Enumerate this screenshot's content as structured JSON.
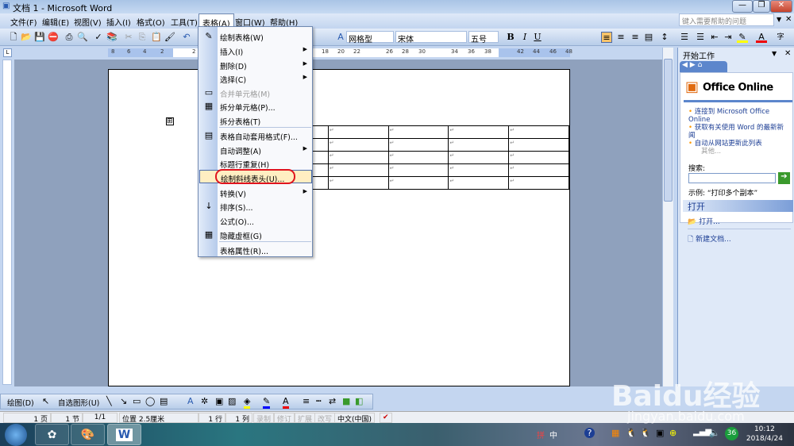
{
  "window": {
    "title": "文档 1 - Microsoft Word",
    "min": "—",
    "max": "❐",
    "close": "✕"
  },
  "menubar": [
    "文件(F)",
    "编辑(E)",
    "视图(V)",
    "插入(I)",
    "格式(O)",
    "工具(T)",
    "表格(A)",
    "窗口(W)",
    "帮助(H)"
  ],
  "help_placeholder": "键入需要帮助的问题",
  "toolbar": {
    "style": "网格型",
    "font": "宋体",
    "size": "五号",
    "bold": "B",
    "italic": "I",
    "underline": "U"
  },
  "ruler_numbers": [
    "8",
    "6",
    "4",
    "2",
    "2",
    "18",
    "20",
    "22",
    "26",
    "28",
    "30",
    "34",
    "36",
    "38",
    "42",
    "44",
    "46",
    "48"
  ],
  "table_menu": [
    {
      "label": "绘制表格(W)",
      "icon": "✎"
    },
    {
      "label": "插入(I)",
      "sub": true
    },
    {
      "label": "删除(D)",
      "sub": true
    },
    {
      "label": "选择(C)",
      "sub": true
    },
    {
      "label": "合并单元格(M)",
      "icon": "▭",
      "disabled": true
    },
    {
      "label": "拆分单元格(P)...",
      "icon": "▦"
    },
    {
      "label": "拆分表格(T)"
    },
    {
      "label": "表格自动套用格式(F)...",
      "icon": "▤"
    },
    {
      "label": "自动调整(A)",
      "sub": true
    },
    {
      "label": "标题行重复(H)"
    },
    {
      "label": "绘制斜线表头(U)...",
      "highlight": true
    },
    {
      "label": "转换(V)",
      "sub": true
    },
    {
      "label": "排序(S)...",
      "icon": "↓"
    },
    {
      "label": "公式(O)..."
    },
    {
      "label": "隐藏虚框(G)",
      "icon": "▦"
    },
    {
      "label": "表格属性(R)..."
    }
  ],
  "table": {
    "rows": 5,
    "cols": 5,
    "cell_mark": "↵"
  },
  "taskpane": {
    "title": "开始工作",
    "logo": "Office Online",
    "links": [
      "连接到 Microsoft Office Online",
      "获取有关使用 Word 的最新新闻",
      "自动从网站更新此列表"
    ],
    "more": "其他...",
    "search_label": "搜索:",
    "search_value": "",
    "example": "示例:  “打印多个副本”",
    "open_header": "打开",
    "open": "打开...",
    "new_doc": "新建文档..."
  },
  "drawbar": {
    "draw": "绘图(D)",
    "autoshapes": "自选图形(U)"
  },
  "status": {
    "page": "1 页",
    "section": "1 节",
    "pages": "1/1",
    "position": "位置 2.5厘米",
    "line": "1 行",
    "col": "1 列",
    "rec": "录制",
    "trk": "修订",
    "ext": "扩展",
    "ovr": "改写",
    "lang": "中文(中国)"
  },
  "clock": {
    "time": "10:12",
    "date": "2018/4/24"
  },
  "tray_badge": "36",
  "watermark": {
    "main": "Baidu经验",
    "url": "jingyan.baidu.com"
  }
}
